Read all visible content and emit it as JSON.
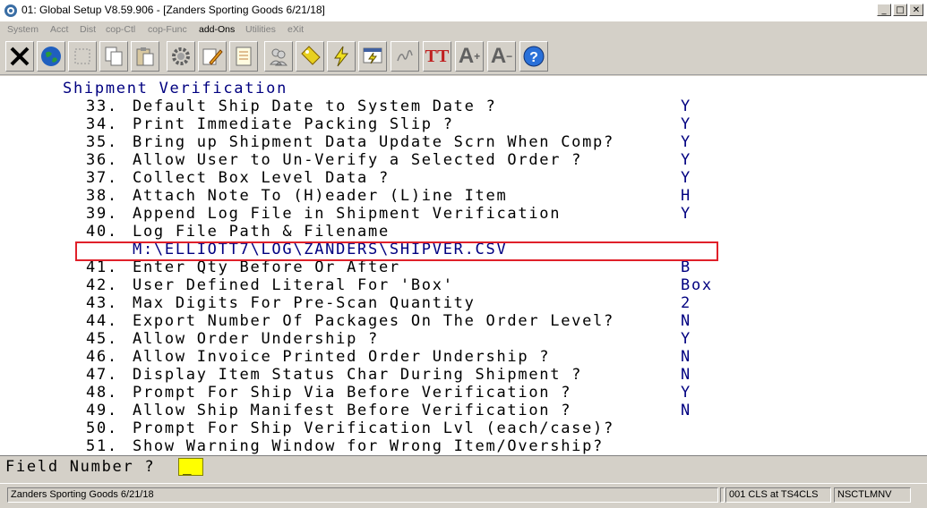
{
  "window": {
    "title": "01: Global Setup V8.59.906 - [Zanders Sporting Goods 6/21/18]",
    "min_label": "_",
    "max_label": "□",
    "close_label": "✕"
  },
  "menu": {
    "items": [
      "System",
      "Acct",
      "Dist",
      "cop-Ctl",
      "cop-Func",
      "add-Ons",
      "Utilities",
      "eXit"
    ]
  },
  "toolbar": {
    "icons": [
      "exit-icon",
      "globe-icon",
      "blank-icon",
      "copy-icon",
      "paste-icon",
      "gear-icon",
      "edit-pencil-icon",
      "notepad-icon",
      "users-icon",
      "tag-icon",
      "lightning-icon",
      "screen-lightning-icon",
      "signature-icon",
      "font-style-icon",
      "font-increase-icon",
      "font-decrease-icon",
      "help-icon"
    ],
    "font_style_label": "TT",
    "font_increase_label": "A",
    "font_decrease_label": "A",
    "help_label": "?"
  },
  "screen": {
    "heading": "Shipment Verification",
    "items": [
      {
        "num": "33.",
        "label": "Default Ship Date to System Date ?",
        "value": "Y"
      },
      {
        "num": "34.",
        "label": "Print Immediate Packing Slip ?",
        "value": "Y"
      },
      {
        "num": "35.",
        "label": "Bring up Shipment Data Update Scrn When Comp?",
        "value": "Y"
      },
      {
        "num": "36.",
        "label": "Allow User to Un-Verify a Selected Order ?",
        "value": "Y"
      },
      {
        "num": "37.",
        "label": "Collect Box Level Data ?",
        "value": "Y"
      },
      {
        "num": "38.",
        "label": "Attach Note To (H)eader (L)ine Item",
        "value": "H"
      },
      {
        "num": "39.",
        "label": "Append Log File in Shipment Verification",
        "value": "Y"
      },
      {
        "num": "40.",
        "label": "Log File Path & Filename",
        "value": ""
      },
      {
        "num": "41.",
        "label": "Enter Qty Before Or After",
        "value": "B"
      },
      {
        "num": "42.",
        "label": "User Defined Literal For 'Box'",
        "value": "Box"
      },
      {
        "num": "43.",
        "label": "Max Digits For Pre-Scan Quantity",
        "value": "2"
      },
      {
        "num": "44.",
        "label": "Export Number Of Packages On The Order Level?",
        "value": "N"
      },
      {
        "num": "45.",
        "label": "Allow Order Undership ?",
        "value": "Y"
      },
      {
        "num": "46.",
        "label": "Allow Invoice Printed Order Undership ?",
        "value": "N"
      },
      {
        "num": "47.",
        "label": "Display Item Status Char During Shipment ?",
        "value": "N"
      },
      {
        "num": "48.",
        "label": "Prompt For Ship Via Before Verification ?",
        "value": "Y"
      },
      {
        "num": "49.",
        "label": "Allow Ship Manifest Before Verification ?",
        "value": "N"
      },
      {
        "num": "50.",
        "label": "Prompt For Ship Verification Lvl (each/case)?",
        "value": ""
      },
      {
        "num": "51.",
        "label": "Show Warning Window for Wrong Item/Overship?",
        "value": ""
      }
    ],
    "log_path": "M:\\ELLIOTT7\\LOG\\ZANDERS\\SHIPVER.CSV"
  },
  "prompt": {
    "label": "Field Number ?",
    "value": "_"
  },
  "status": {
    "company": "Zanders Sporting Goods 6/21/18",
    "blank": "",
    "session": "001 CLS at TS4CLS",
    "program": "NSCTLMNV"
  },
  "colors": {
    "highlight_box": "#e0202a",
    "value_text": "#000080",
    "input_bg": "#ffff00"
  }
}
